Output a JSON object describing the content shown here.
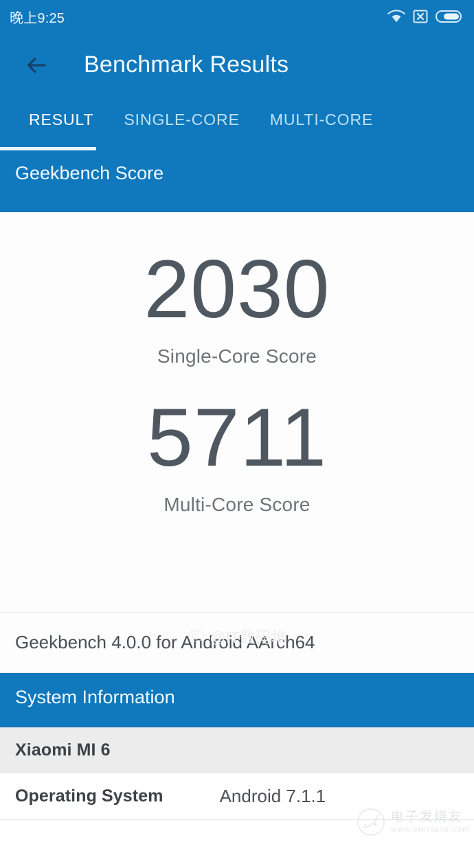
{
  "statusbar": {
    "time": "晚上9:25",
    "icons": [
      "wifi-icon",
      "no-signal-icon",
      "battery-icon"
    ]
  },
  "appbar": {
    "back_icon": "back-arrow-icon",
    "title": "Benchmark Results"
  },
  "tabs": [
    {
      "label": "RESULT",
      "active": true
    },
    {
      "label": "SINGLE-CORE",
      "active": false
    },
    {
      "label": "MULTI-CORE",
      "active": false
    }
  ],
  "sections": {
    "geekbench_score_header": "Geekbench Score",
    "system_information_header": "System Information"
  },
  "scores": [
    {
      "value": "2030",
      "label": "Single-Core Score"
    },
    {
      "value": "5711",
      "label": "Multi-Core Score"
    }
  ],
  "version_row": "Geekbench 4.0.0 for Android AArch64",
  "system_information": {
    "device": "Xiaomi MI 6",
    "rows": [
      {
        "key": "Operating System",
        "value": "Android 7.1.1"
      }
    ]
  },
  "watermarks": {
    "weibo": "@IT数码堆",
    "site_cn": "电子发烧友",
    "site_url": "www.elecfans.com"
  },
  "colors": {
    "accent_blue": "#1078bd",
    "score_text": "#4f5860",
    "device_row_bg": "#ececec"
  }
}
